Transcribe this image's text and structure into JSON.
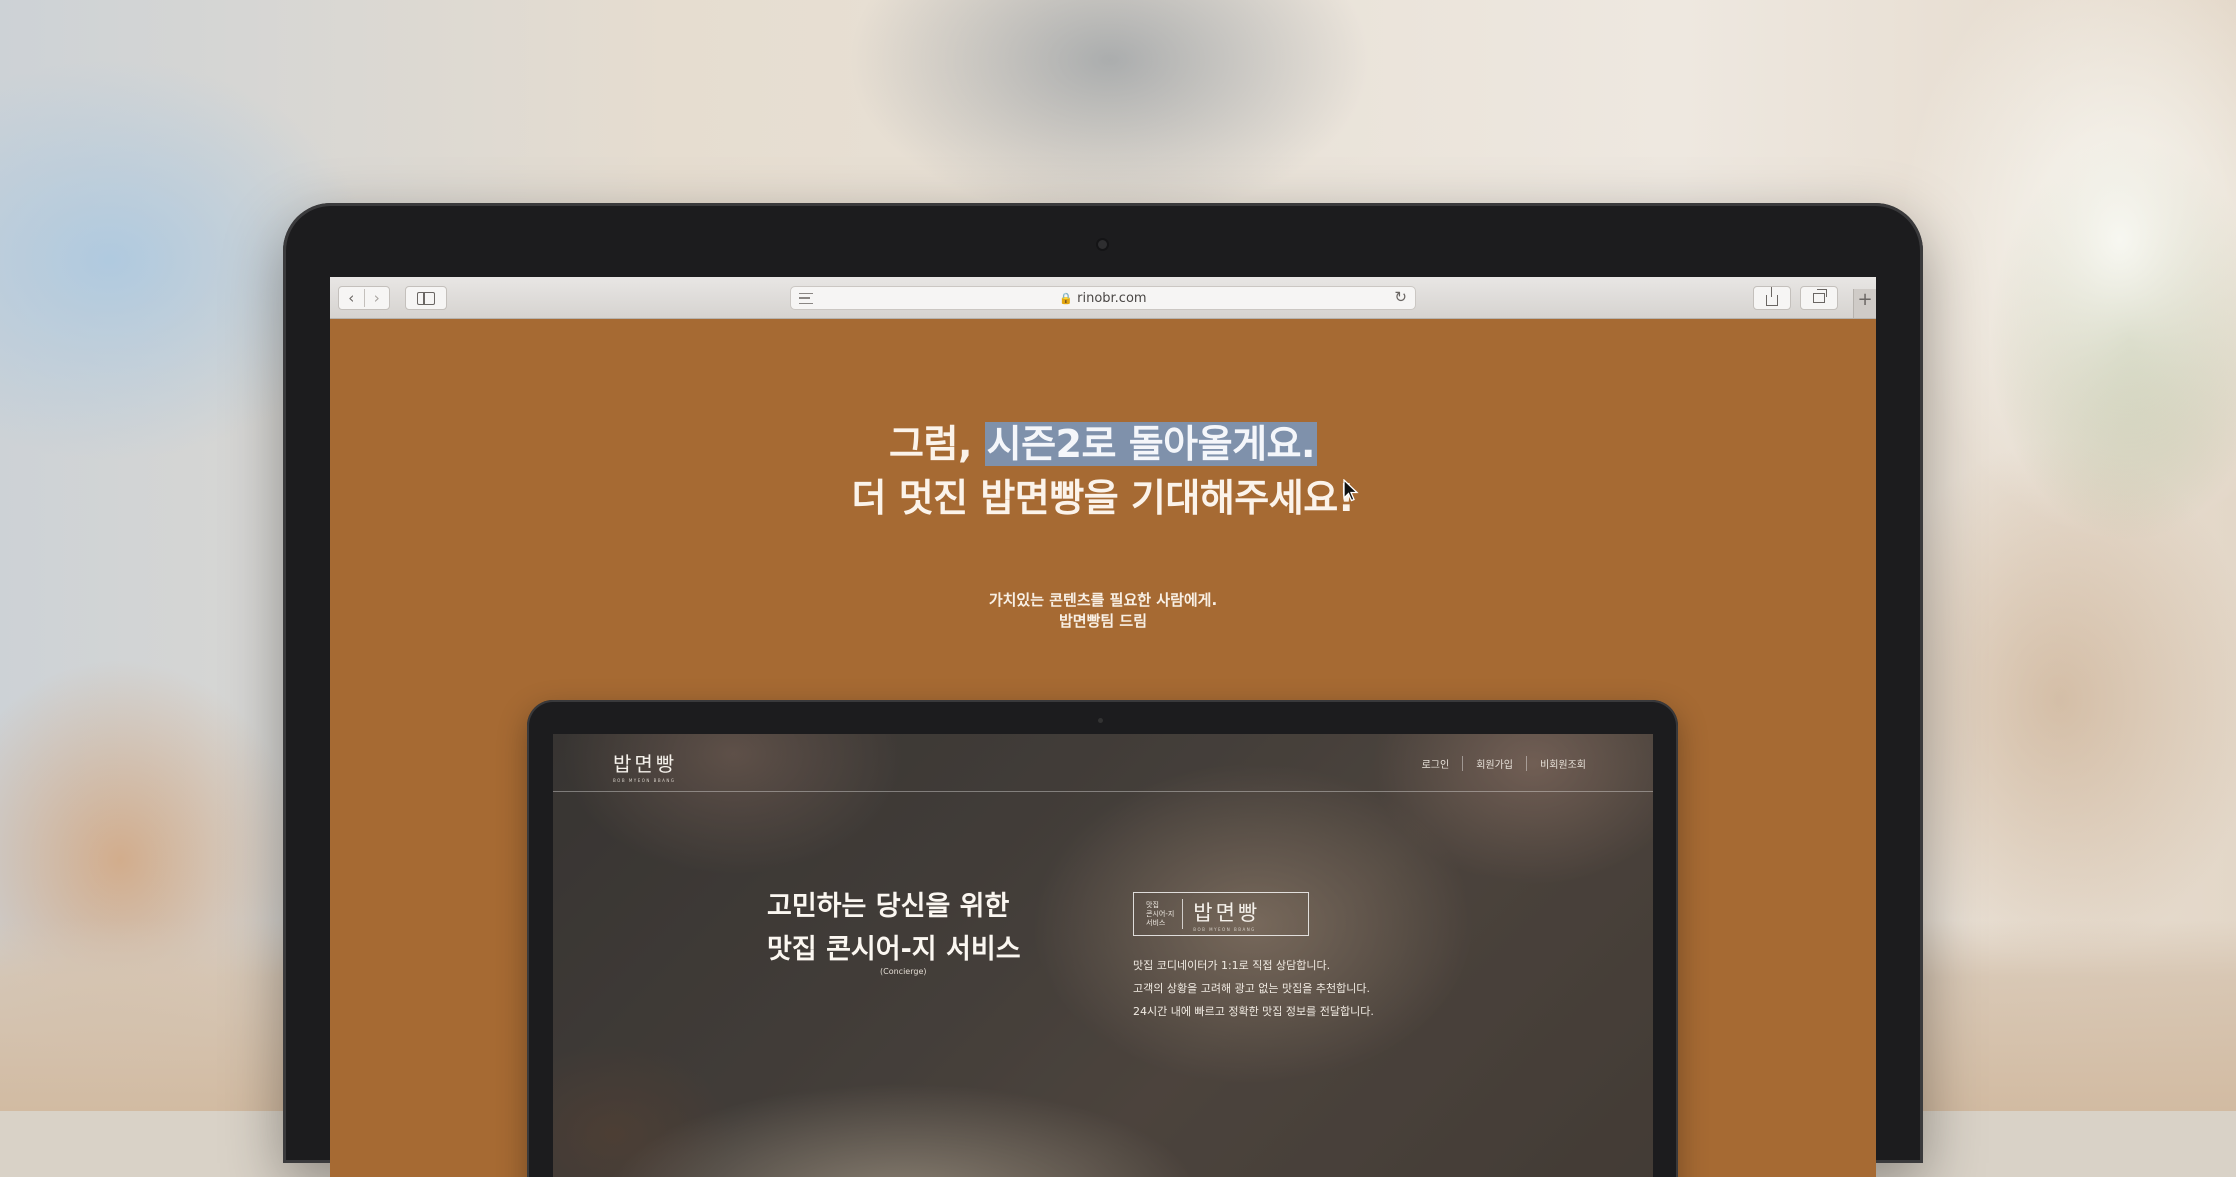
{
  "browser": {
    "url": "rinobr.com",
    "nav_back": "‹",
    "nav_forward": "›",
    "reload_icon": "↻",
    "new_tab": "+",
    "lock_icon": "🔒"
  },
  "hero": {
    "headline_part1": "그럼, ",
    "headline_selected": "시즌2로 돌아올게요.",
    "headline_line2": "더 멋진 밥면빵을 기대해주세요!",
    "sub_line1": "가치있는 콘텐츠를 필요한 사람에게.",
    "sub_line2": "밥면빵팀 드림"
  },
  "mock": {
    "logo": "밥면빵",
    "logo_sub": "BOB MYEON BBANG",
    "nav": [
      "로그인",
      "회원가입",
      "비회원조회"
    ],
    "title_line1": "고민하는 당신을 위한",
    "title_line2": "맛집 콘시어-지 서비스",
    "title_note": "(Concierge)",
    "badge_small": [
      "맛집",
      "콘시어-지",
      "서비스"
    ],
    "badge_logo": "밥면빵",
    "badge_logo_sub": "BOB MYEON BBANG",
    "features": [
      "맛집 코디네이터가 1:1로 직접 상담합니다.",
      "고객의 상황을 고려해 광고 없는 맛집을 추천합니다.",
      "24시간 내에 빠르고 정확한 맛집 정보를 전달합니다."
    ]
  },
  "colors": {
    "page_accent": "#a66a33",
    "selection": "#7f91ab",
    "text_light": "#fbf3ea"
  }
}
